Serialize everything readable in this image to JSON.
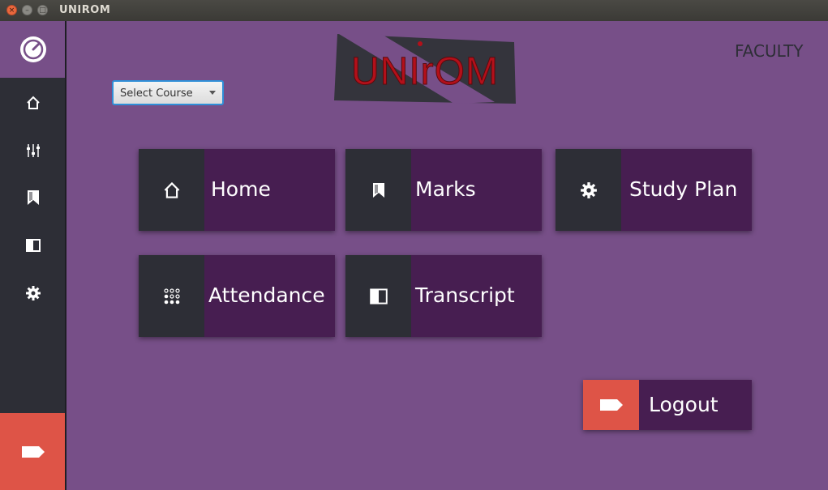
{
  "window": {
    "title": "UNIROM"
  },
  "header": {
    "role_label": "FACULTY",
    "logo_text": "UNIrOM",
    "course_select": {
      "selected": "Select Course"
    }
  },
  "sidebar": {
    "items": [
      {
        "icon": "dashboard-icon"
      },
      {
        "icon": "home-icon"
      },
      {
        "icon": "sliders-icon"
      },
      {
        "icon": "bookmark-icon"
      },
      {
        "icon": "transcript-icon"
      },
      {
        "icon": "gear-icon"
      },
      {
        "icon": "logout-icon"
      }
    ]
  },
  "tiles": [
    {
      "label": "Home",
      "icon": "home-icon"
    },
    {
      "label": "Marks",
      "icon": "bookmark-icon"
    },
    {
      "label": "Study Plan",
      "icon": "gear-icon"
    },
    {
      "label": "Attendance",
      "icon": "dots-grid-icon"
    },
    {
      "label": "Transcript",
      "icon": "transcript-icon"
    }
  ],
  "logout": {
    "label": "Logout",
    "icon": "logout-icon"
  },
  "colors": {
    "background": "#774f88",
    "sidebar": "#2d2e36",
    "tile": "#471e51",
    "accent_red": "#de5447",
    "select_border": "#2f8fd8"
  }
}
